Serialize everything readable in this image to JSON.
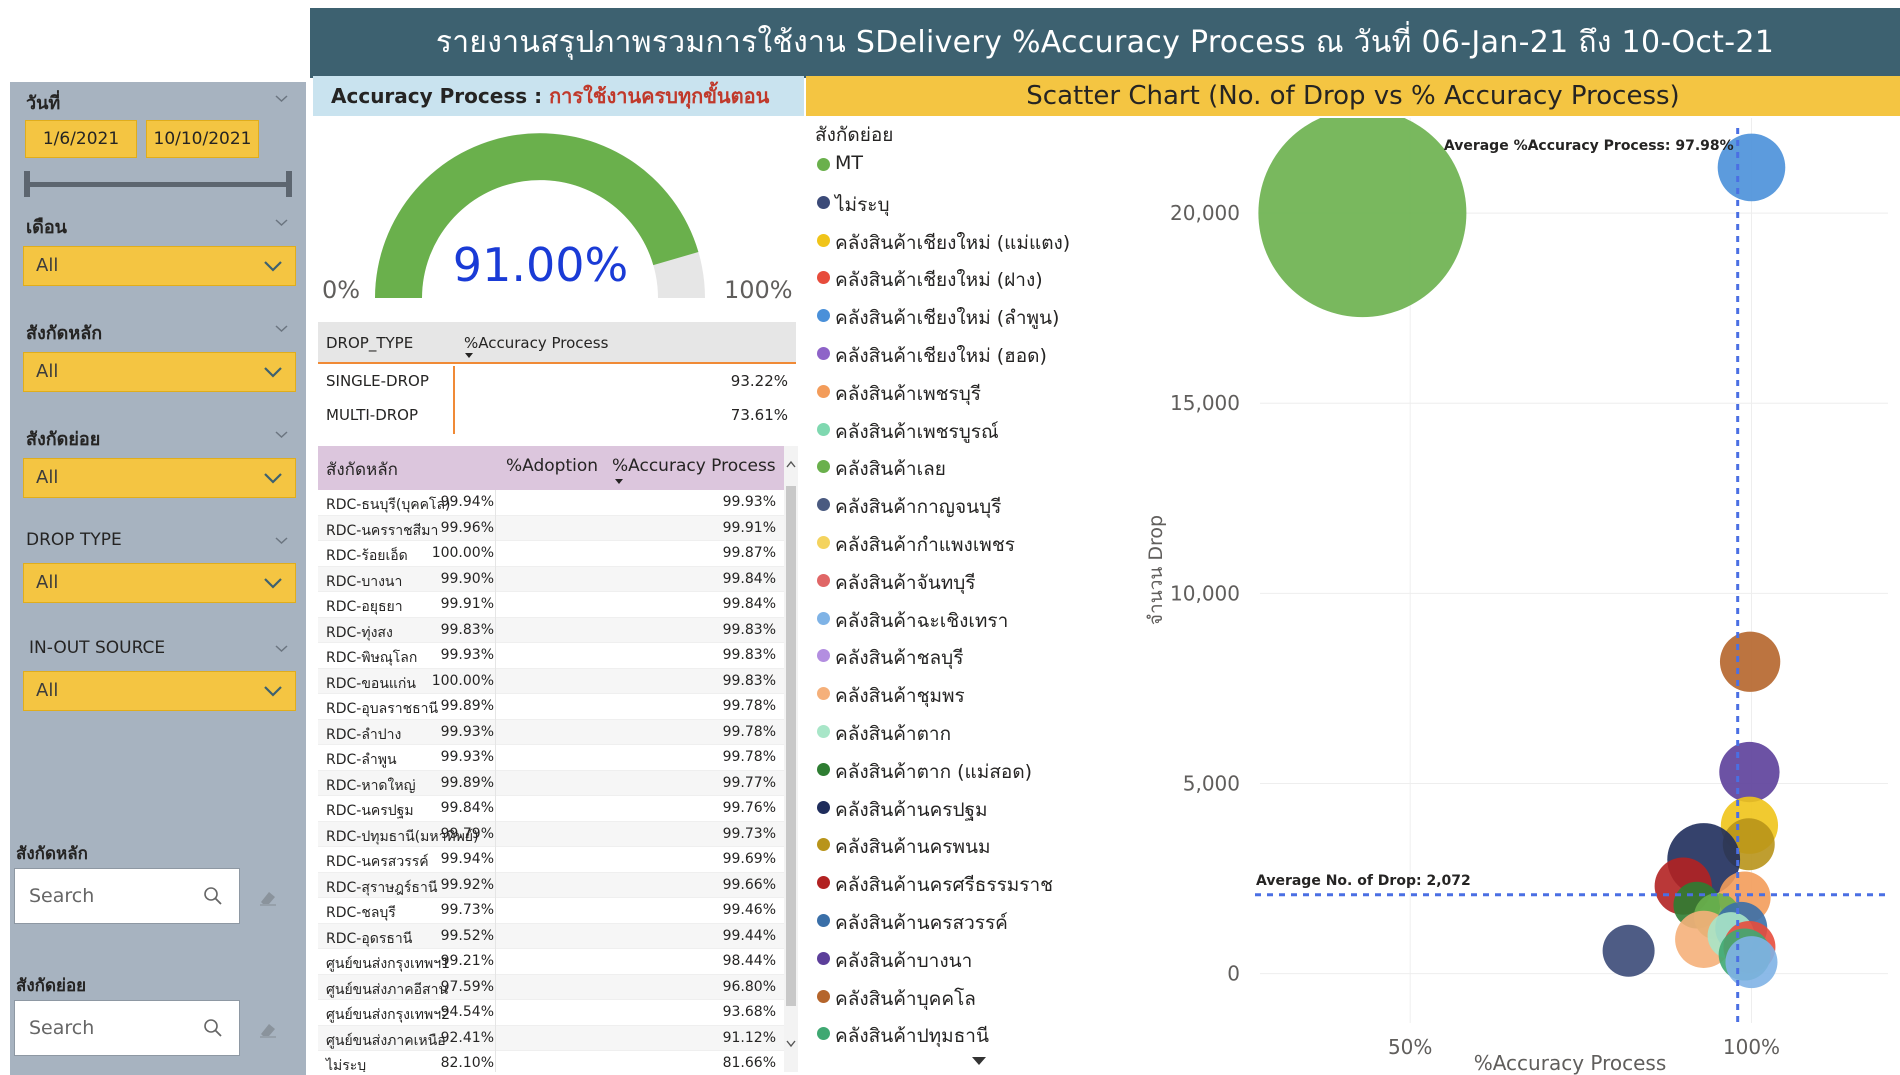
{
  "header": {
    "title": "รายงานสรุปภาพรวมการใช้งาน SDelivery %Accuracy Process ณ วันที่ 06-Jan-21 ถึง 10-Oct-21"
  },
  "filters": {
    "date": {
      "label": "วันที่",
      "start": "1/6/2021",
      "end": "10/10/2021"
    },
    "month": {
      "label": "เดือน",
      "value": "All"
    },
    "main_unit": {
      "label": "สังกัดหลัก",
      "value": "All"
    },
    "sub_unit": {
      "label": "สังกัดย่อย",
      "value": "All"
    },
    "drop_type": {
      "label": "DROP TYPE",
      "value": "All"
    },
    "inout": {
      "label": "IN-OUT SOURCE",
      "value": "All"
    },
    "search_main": {
      "label": "สังกัดหลัก",
      "placeholder": "Search"
    },
    "search_sub": {
      "label": "สังกัดย่อย",
      "placeholder": "Search"
    }
  },
  "gauge": {
    "title_prefix": "Accuracy Process : ",
    "title_suffix": "การใช้งานครบทุกขั้นตอน",
    "value_label": "91.00%",
    "value": 0.91,
    "min_label": "0%",
    "max_label": "100%",
    "color": "#6ab04c"
  },
  "drop_table": {
    "col1": "DROP_TYPE",
    "col2": "%Accuracy Process",
    "rows": [
      {
        "type": "SINGLE-DROP",
        "value": "93.22%"
      },
      {
        "type": "MULTI-DROP",
        "value": "73.61%"
      }
    ]
  },
  "main_table": {
    "col1": "สังกัดหลัก",
    "col2": "%Adoption",
    "col3": "%Accuracy Process",
    "rows": [
      [
        "RDC-ธนบุรี(บุคคโล)",
        "99.94%",
        "99.93%"
      ],
      [
        "RDC-นครราชสีมา",
        "99.96%",
        "99.91%"
      ],
      [
        "RDC-ร้อยเอ็ด",
        "100.00%",
        "99.87%"
      ],
      [
        "RDC-บางนา",
        "99.90%",
        "99.84%"
      ],
      [
        "RDC-อยุธยา",
        "99.91%",
        "99.84%"
      ],
      [
        "RDC-ทุ่งสง",
        "99.83%",
        "99.83%"
      ],
      [
        "RDC-พิษณุโลก",
        "99.93%",
        "99.83%"
      ],
      [
        "RDC-ขอนแก่น",
        "100.00%",
        "99.83%"
      ],
      [
        "RDC-อุบลราชธานี",
        "99.89%",
        "99.78%"
      ],
      [
        "RDC-ลำปาง",
        "99.93%",
        "99.78%"
      ],
      [
        "RDC-ลำพูน",
        "99.93%",
        "99.78%"
      ],
      [
        "RDC-หาดใหญ่",
        "99.89%",
        "99.77%"
      ],
      [
        "RDC-นครปฐม",
        "99.84%",
        "99.76%"
      ],
      [
        "RDC-ปทุมธานี(มหาทิพย์)",
        "99.79%",
        "99.73%"
      ],
      [
        "RDC-นครสวรรค์",
        "99.94%",
        "99.69%"
      ],
      [
        "RDC-สุราษฎร์ธานี",
        "99.92%",
        "99.66%"
      ],
      [
        "RDC-ชลบุรี",
        "99.73%",
        "99.46%"
      ],
      [
        "RDC-อุดรธานี",
        "99.52%",
        "99.44%"
      ],
      [
        "ศูนย์ขนส่งกรุงเทพฯ1",
        "99.21%",
        "98.44%"
      ],
      [
        "ศูนย์ขนส่งภาคอีสาน",
        "97.59%",
        "96.80%"
      ],
      [
        "ศูนย์ขนส่งกรุงเทพฯ2",
        "94.54%",
        "93.68%"
      ],
      [
        "ศูนย์ขนส่งภาคเหนือ",
        "92.41%",
        "91.12%"
      ],
      [
        "ไม่ระบุ",
        "82.10%",
        "81.66%"
      ]
    ]
  },
  "scatter": {
    "title": "Scatter Chart (No. of Drop vs % Accuracy Process)",
    "legend_title": "สังกัดย่อย",
    "legend": [
      {
        "name": "MT",
        "color": "#6ab04c"
      },
      {
        "name": "ไม่ระบุ",
        "color": "#3b4a78"
      },
      {
        "name": "คลังสินค้าเชียงใหม่ (แม่แตง)",
        "color": "#f0c419"
      },
      {
        "name": "คลังสินค้าเชียงใหม่ (ฝาง)",
        "color": "#e74c3c"
      },
      {
        "name": "คลังสินค้าเชียงใหม่ (ลำพูน)",
        "color": "#4a90d9"
      },
      {
        "name": "คลังสินค้าเชียงใหม่ (ฮอด)",
        "color": "#8e63c8"
      },
      {
        "name": "คลังสินค้าเพชรบุรี",
        "color": "#f39c5a"
      },
      {
        "name": "คลังสินค้าเพชรบูรณ์",
        "color": "#7fd8b0"
      },
      {
        "name": "คลังสินค้าเลย",
        "color": "#6ab04c"
      },
      {
        "name": "คลังสินค้ากาญจนบุรี",
        "color": "#4a5a80"
      },
      {
        "name": "คลังสินค้ากำแพงเพชร",
        "color": "#f4d35e"
      },
      {
        "name": "คลังสินค้าจันทบุรี",
        "color": "#e06666"
      },
      {
        "name": "คลังสินค้าฉะเชิงเทรา",
        "color": "#7fb3e6"
      },
      {
        "name": "คลังสินค้าชลบุรี",
        "color": "#b38ee0"
      },
      {
        "name": "คลังสินค้าชุมพร",
        "color": "#f5b07a"
      },
      {
        "name": "คลังสินค้าตาก",
        "color": "#a8e6c8"
      },
      {
        "name": "คลังสินค้าตาก (แม่สอด)",
        "color": "#2e7d32"
      },
      {
        "name": "คลังสินค้านครปฐม",
        "color": "#1f2d5c"
      },
      {
        "name": "คลังสินค้านครพนม",
        "color": "#b8941a"
      },
      {
        "name": "คลังสินค้านครศรีธรรมราช",
        "color": "#b22222"
      },
      {
        "name": "คลังสินค้านครสวรรค์",
        "color": "#3a6fa8"
      },
      {
        "name": "คลังสินค้าบางนา",
        "color": "#5c3f9a"
      },
      {
        "name": "คลังสินค้าบุคคโล",
        "color": "#b5652b"
      },
      {
        "name": "คลังสินค้าปทุมธานี",
        "color": "#3fa872"
      }
    ]
  },
  "chart_data": {
    "type": "scatter",
    "title": "Scatter Chart (No. of Drop vs % Accuracy Process)",
    "xlabel": "%Accuracy Process",
    "ylabel": "จำนวน Drop",
    "xlim": [
      0.28,
      1.2
    ],
    "ylim": [
      -1300,
      22500
    ],
    "x_ticks": [
      0.5,
      1.0
    ],
    "x_tick_labels": [
      "50%",
      "100%"
    ],
    "y_ticks": [
      0,
      5000,
      10000,
      15000,
      20000
    ],
    "y_tick_labels": [
      "0",
      "5,000",
      "10,000",
      "15,000",
      "20,000"
    ],
    "grid": true,
    "avg_x": 0.9798,
    "avg_x_label": "Average %Accuracy Process: 97.98%",
    "avg_y": 2072,
    "avg_y_label": "Average No. of Drop: 2,072",
    "points": [
      {
        "series": "MT",
        "x": 0.43,
        "y": 20000,
        "size": 2.0,
        "color": "#6ab04c"
      },
      {
        "series": "คลังสินค้าเชียงใหม่ (ลำพูน)",
        "x": 1.0,
        "y": 21200,
        "size": 0.65,
        "color": "#4a90d9"
      },
      {
        "series": "คลังสินค้าบุคคโล",
        "x": 0.998,
        "y": 8200,
        "size": 0.58,
        "color": "#b5652b"
      },
      {
        "series": "คลังสินค้าบางนา",
        "x": 0.997,
        "y": 5300,
        "size": 0.58,
        "color": "#5c3f9a"
      },
      {
        "series": "คลังสินค้าเชียงใหม่ (แม่แตง)",
        "x": 0.997,
        "y": 3900,
        "size": 0.55,
        "color": "#f0c419"
      },
      {
        "series": "คลังสินค้านครพนม",
        "x": 0.996,
        "y": 3400,
        "size": 0.5,
        "color": "#b8941a"
      },
      {
        "series": "คลังสินค้านครปฐม",
        "x": 0.93,
        "y": 3000,
        "size": 0.7,
        "color": "#1f2d5c"
      },
      {
        "series": "คลังสินค้านครศรีธรรมราช",
        "x": 0.9,
        "y": 2300,
        "size": 0.55,
        "color": "#b22222"
      },
      {
        "series": "คลังสินค้าตาก (แม่สอด)",
        "x": 0.92,
        "y": 1800,
        "size": 0.45,
        "color": "#2e7d32"
      },
      {
        "series": "คลังสินค้าเพชรบุรี",
        "x": 0.99,
        "y": 2000,
        "size": 0.5,
        "color": "#f39c5a"
      },
      {
        "series": "คลังสินค้าเลย",
        "x": 0.95,
        "y": 1500,
        "size": 0.45,
        "color": "#6ab04c"
      },
      {
        "series": "คลังสินค้าชุมพร",
        "x": 0.93,
        "y": 900,
        "size": 0.55,
        "color": "#f5b07a"
      },
      {
        "series": "คลังสินค้านครสวรรค์",
        "x": 0.985,
        "y": 1200,
        "size": 0.5,
        "color": "#3a6fa8"
      },
      {
        "series": "คลังสินค้าตาก",
        "x": 0.97,
        "y": 1000,
        "size": 0.45,
        "color": "#a8e6c8"
      },
      {
        "series": "คลังสินค้าเชียงใหม่ (ฝาง)",
        "x": 0.997,
        "y": 700,
        "size": 0.5,
        "color": "#e74c3c"
      },
      {
        "series": "คลังสินค้าปทุมธานี",
        "x": 0.99,
        "y": 500,
        "size": 0.5,
        "color": "#3fa872"
      },
      {
        "series": "คลังสินค้าฉะเชิงเทรา",
        "x": 1.0,
        "y": 300,
        "size": 0.5,
        "color": "#7fb3e6"
      },
      {
        "series": "ไม่ระบุ",
        "x": 0.82,
        "y": 600,
        "size": 0.5,
        "color": "#3b4a78"
      }
    ]
  }
}
